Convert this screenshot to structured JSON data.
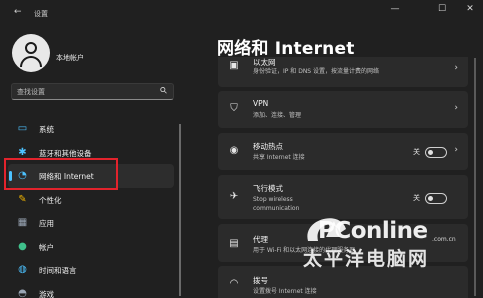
{
  "window": {
    "title": "设置"
  },
  "account": {
    "name": "本地帐户"
  },
  "search": {
    "placeholder": "查找设置"
  },
  "sidebar": {
    "items": [
      {
        "label": "系统",
        "icon": "display-icon",
        "color": "#4cc2ff"
      },
      {
        "label": "蓝牙和其他设备",
        "icon": "bluetooth-icon",
        "color": "#4cc2ff"
      },
      {
        "label": "网络和 Internet",
        "icon": "wifi-icon",
        "color": "#4cc2ff",
        "active": true
      },
      {
        "label": "个性化",
        "icon": "brush-icon",
        "color": "#f0b400"
      },
      {
        "label": "应用",
        "icon": "apps-icon",
        "color": "#9aa6b5"
      },
      {
        "label": "帐户",
        "icon": "person-icon",
        "color": "#3fc08b"
      },
      {
        "label": "时间和语言",
        "icon": "globe-icon",
        "color": "#4cc2ff"
      },
      {
        "label": "游戏",
        "icon": "gamepad-icon",
        "color": "#9aa6b5"
      }
    ]
  },
  "main": {
    "title": "网络和 Internet",
    "cards": [
      {
        "title": "以太网",
        "subtitle": "身份验证，IP 和 DNS 设置，按流量计费的网络",
        "icon": "ethernet-icon"
      },
      {
        "title": "VPN",
        "subtitle": "添加、连接、管理",
        "icon": "vpn-shield-icon"
      },
      {
        "title": "移动热点",
        "subtitle": "共享 Internet 连接",
        "icon": "hotspot-icon",
        "toggle_label": "关",
        "toggle_on": false
      },
      {
        "title": "飞行模式",
        "subtitle": "Stop wireless communication",
        "icon": "airplane-icon",
        "toggle_label": "关",
        "toggle_on": false
      },
      {
        "title": "代理",
        "subtitle": "用于 Wi-Fi 和以太网连接的代理服务器",
        "icon": "proxy-icon"
      },
      {
        "title": "拨号",
        "subtitle": "设置拨号 Internet 连接",
        "icon": "dialup-icon"
      }
    ]
  },
  "watermark": {
    "brand": "PConline",
    "cn": "太平洋电脑网",
    "url": ".com.cn"
  },
  "colors": {
    "accent": "#4cc2ff",
    "highlight": "#e2232c",
    "background": "#202020",
    "card": "#2b2b2b"
  }
}
